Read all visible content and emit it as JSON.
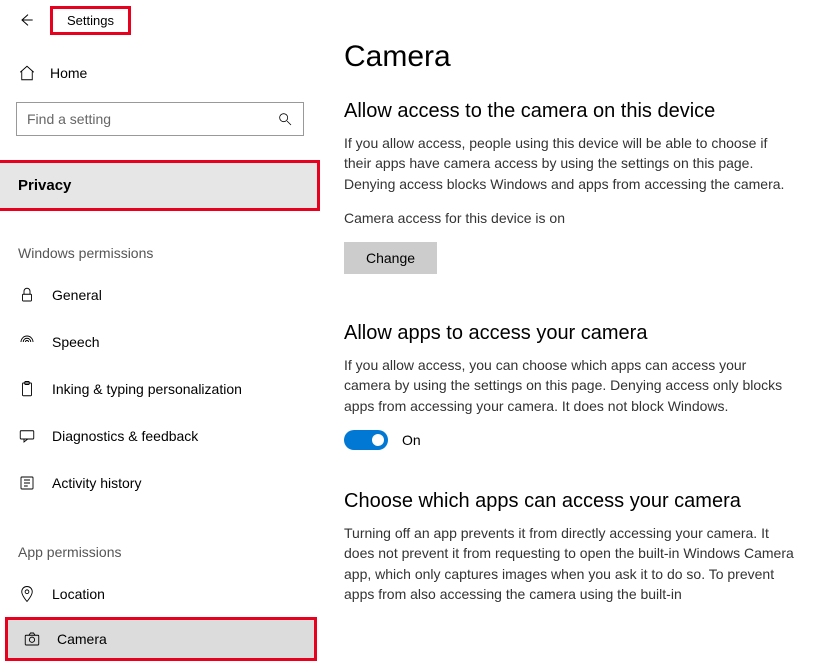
{
  "header": {
    "title": "Settings"
  },
  "sidebar": {
    "home": "Home",
    "search_placeholder": "Find a setting",
    "privacy": "Privacy",
    "section_windows": "Windows permissions",
    "section_app": "App permissions",
    "items_win": [
      {
        "label": "General"
      },
      {
        "label": "Speech"
      },
      {
        "label": "Inking & typing personalization"
      },
      {
        "label": "Diagnostics & feedback"
      },
      {
        "label": "Activity history"
      }
    ],
    "items_app": [
      {
        "label": "Location"
      },
      {
        "label": "Camera"
      }
    ]
  },
  "main": {
    "title": "Camera",
    "h2a": "Allow access to the camera on this device",
    "p1": "If you allow access, people using this device will be able to choose if their apps have camera access by using the settings on this page. Denying access blocks Windows and apps from accessing the camera.",
    "status": "Camera access for this device is on",
    "change": "Change",
    "h2b": "Allow apps to access your camera",
    "p2": "If you allow access, you can choose which apps can access your camera by using the settings on this page. Denying access only blocks apps from accessing your camera. It does not block Windows.",
    "toggle_state": "On",
    "h2c": "Choose which apps can access your camera",
    "p3": "Turning off an app prevents it from directly accessing your camera. It does not prevent it from requesting to open the built-in Windows Camera app, which only captures images when you ask it to do so. To prevent apps from also accessing the camera using the built-in"
  }
}
